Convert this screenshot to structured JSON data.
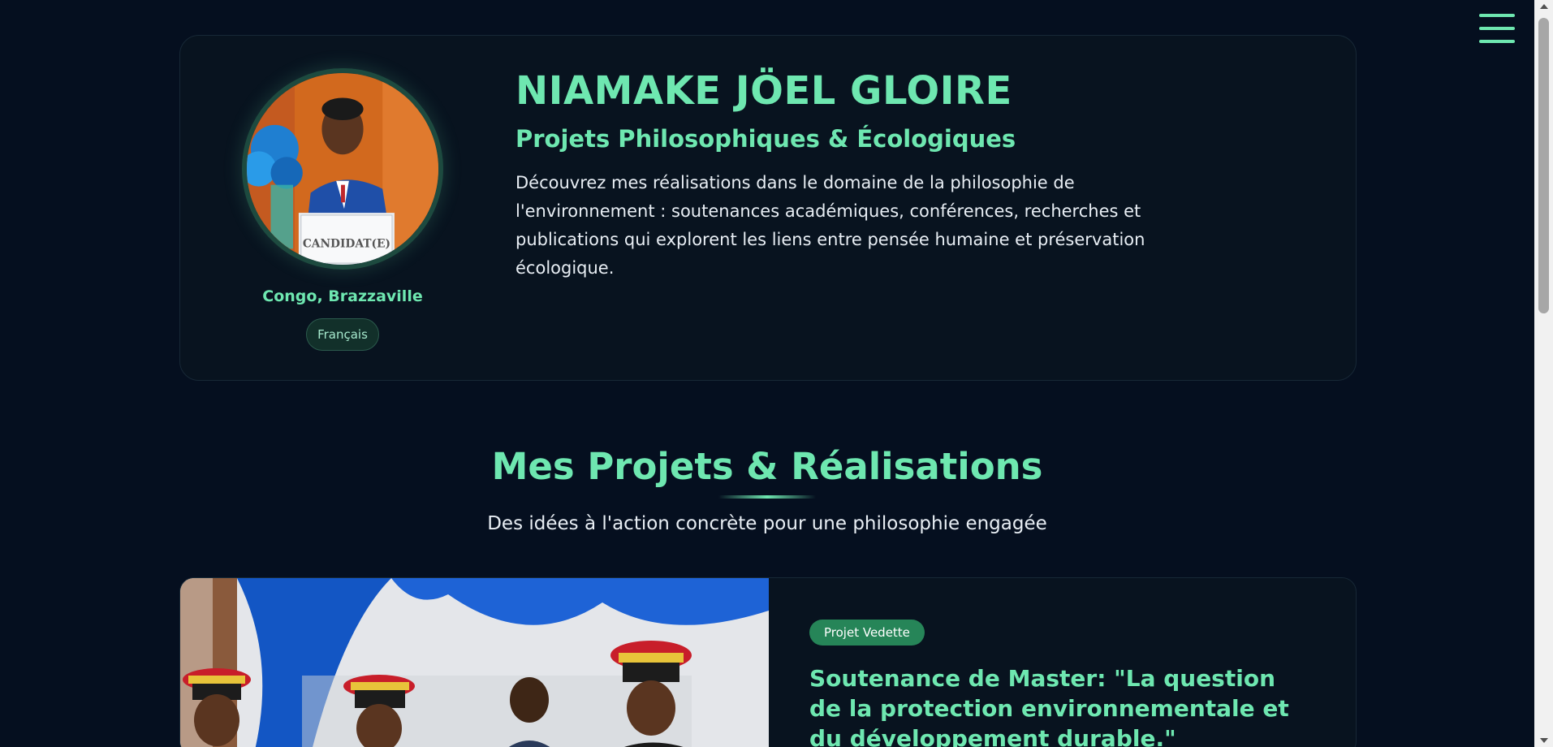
{
  "header": {
    "menu_icon": "hamburger-menu-icon",
    "accent_color": "#6ee7b0"
  },
  "profile": {
    "name": "NIAMAKE JÖEL GLOIRE",
    "role": "Projets Philosophiques & Écologiques",
    "intro": "Découvrez mes réalisations dans le domaine de la philosophie de l'environnement : soutenances académiques, conférences, recherches et publications qui explorent les liens entre pensée humaine et préservation écologique.",
    "location": "Congo, Brazzaville",
    "language": "Français",
    "photo_placard": "CANDIDAT(E)"
  },
  "projects_section": {
    "title": "Mes Projets & Réalisations",
    "subtitle": "Des idées à l'action concrète pour une philosophie engagée"
  },
  "featured_project": {
    "badge": "Projet Vedette",
    "title": "Soutenance de Master: \"La question de la protection environnementale et du développement durable.\""
  },
  "colors": {
    "background": "#050f1f",
    "card": "#08131f",
    "accent": "#6ee7b0",
    "badge": "#268558"
  }
}
